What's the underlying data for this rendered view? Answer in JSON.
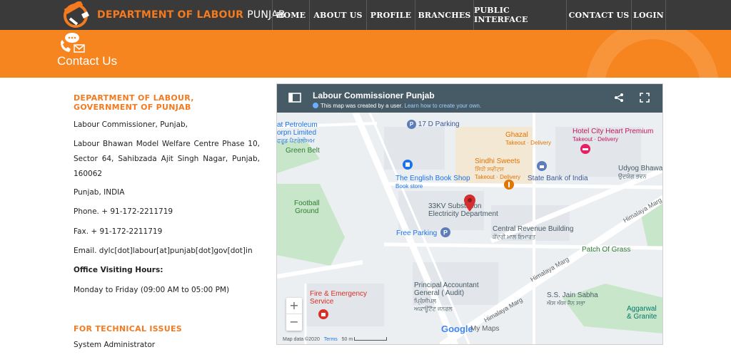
{
  "brand": {
    "name_part1": "DEPARTMENT OF LABOUR",
    "name_part2": "PUNJAB"
  },
  "nav": [
    {
      "label": "HOME"
    },
    {
      "label": "ABOUT US"
    },
    {
      "label": "PROFILE"
    },
    {
      "label": "BRANCHES"
    },
    {
      "label": "PUBLIC INTERFACE"
    },
    {
      "label": "CONTACT US"
    },
    {
      "label": "LOGIN"
    }
  ],
  "banner": {
    "title": "Contact Us"
  },
  "contact": {
    "heading": "DEPARTMENT OF LABOUR, GOVERNMENT OF PUNJAB",
    "office": "Labour Commissioner, Punjab,",
    "address": "Labour Bhawan Model Welfare Centre Phase 10, Sector 64, Sahibzada Ajit Singh Nagar, Punjab, 160062",
    "state": "Punjab, INDIA",
    "phone": "Phone.  + 91-172-2211719",
    "fax": "Fax.  + 91-172-2211719",
    "email": "Email.  dylc[dot]labour[at]punjab[dot]gov[dot]in",
    "hours_label": "Office Visiting Hours:",
    "hours": "Monday to Friday (09:00 AM to 05:00 PM)",
    "tech_heading": "FOR TECHNICAL ISSUES",
    "tech_contact": "System Administrator"
  },
  "map": {
    "title": "Labour Commissioner Punjab",
    "subtitle": "This map was created by a user.",
    "subtitle_link": "Learn how to create your own.",
    "labels": {
      "petroleum1": "at Petroleum",
      "petroleum2": "orpn Limited",
      "petroleum3": "ਫਰੂਡ ਪੈਟਰੋਲੀਅਮ",
      "green_belt": "Green Belt",
      "football1": "Football",
      "football2": "Ground",
      "parking17d": "17 D Parking",
      "ghazal": "Ghazal",
      "ghazal_sub": "Takeout · Delivery",
      "hotel": "Hotel City Heart Premium",
      "hotel_sub": "Takeout · Delivery",
      "sindhi": "Sindhi Sweets",
      "sindhi_pa": "ਸਿੰਧੀ ਸਵੀਟਸ",
      "sindhi_sub": "Takeout · Delivery",
      "udyog": "Udyog Bhawa",
      "udyog_pa": "ਉਦਯੋਗ ਭਵਨ",
      "book": "The English Book Shop",
      "book_sub": "Book store",
      "sbi": "State Bank of India",
      "himalaya": "Himalaya Marg",
      "kv33_1": "33KV Substation",
      "kv33_2": "Electricity Department",
      "free_parking": "Free Parking",
      "crb": "Central Revenue Building",
      "crb_pa": "ਕੇਂਦਰੀ ਮਾਲ ਇਮਾਰਤ",
      "patch": "Patch Of Grass",
      "pag1": "Principal Accountant",
      "pag2": "General ( Audit)",
      "pag_pa1": "ਪ੍ਰਿੰਸੀਪਲ",
      "pag_pa2": "ਅਕਾਊਂਟੈਂਟ ਜਨਰਲ",
      "fire1": "Fire & Emergency",
      "fire2": "Service",
      "jain": "S.S. Jain Sabha",
      "jain_pa": "ਐਸ ਐਸ ਜੈਨ ਸਭਾ",
      "aggarwal1": "Aggarwal",
      "aggarwal2": "& Granite"
    },
    "zoom_in": "+",
    "zoom_out": "−",
    "attribution": "Map data ©2020",
    "terms": "Terms",
    "scale": "50 m",
    "google": "Google",
    "my_maps": "My Maps"
  },
  "colors": {
    "accent": "#f37a1f",
    "banner": "#f7851f",
    "nav_bg": "#3a3a3a",
    "map_header": "#465b66"
  }
}
